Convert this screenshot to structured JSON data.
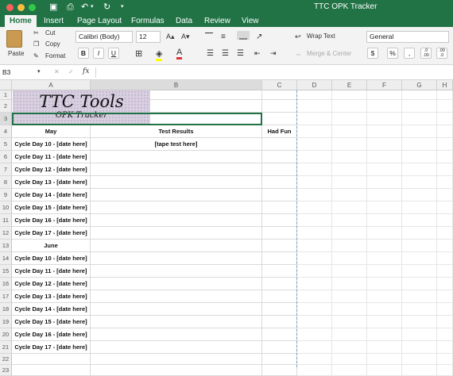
{
  "window": {
    "title": "TTC OPK Tracker"
  },
  "tabs": [
    "Home",
    "Insert",
    "Page Layout",
    "Formulas",
    "Data",
    "Review",
    "View"
  ],
  "ribbon": {
    "paste": "Paste",
    "cut": "Cut",
    "copy": "Copy",
    "format": "Format",
    "font_name": "Calibri (Body)",
    "font_size": "12",
    "bold": "B",
    "italic": "I",
    "underline": "U",
    "wrap_text": "Wrap Text",
    "merge_center": "Merge & Center",
    "number_format": "General",
    "currency": "$",
    "percent": "%",
    "comma": ",",
    "inc_decimal": ".0 .00",
    "dec_decimal": ".00 .0"
  },
  "formula_bar": {
    "name_box": "B3",
    "fx": "fx",
    "content": ""
  },
  "columns": [
    "A",
    "B",
    "C",
    "D",
    "E",
    "F",
    "G",
    "H"
  ],
  "rows": [
    "1",
    "2",
    "3",
    "4",
    "5",
    "6",
    "7",
    "8",
    "9",
    "10",
    "11",
    "12",
    "13",
    "14",
    "15",
    "16",
    "17",
    "18",
    "19",
    "20",
    "21",
    "22",
    "23"
  ],
  "logo": {
    "title": "TTC Tools",
    "subtitle": "OPK Tracker"
  },
  "sheet": {
    "headers": {
      "a": "May",
      "b": "Test Results",
      "c": "Had Fun"
    },
    "rows": [
      {
        "row": "5",
        "a": "Cycle Day 10 - [date here]",
        "b": "[tape test here]"
      },
      {
        "row": "6",
        "a": "Cycle Day 11 - [date here]",
        "b": ""
      },
      {
        "row": "7",
        "a": "Cycle Day 12 - [date here]",
        "b": ""
      },
      {
        "row": "8",
        "a": "Cycle Day 13 - [date here]",
        "b": ""
      },
      {
        "row": "9",
        "a": "Cycle Day 14 - [date here]",
        "b": ""
      },
      {
        "row": "10",
        "a": "Cycle Day 15 - [date here]",
        "b": ""
      },
      {
        "row": "11",
        "a": "Cycle Day 16 - [date here]",
        "b": ""
      },
      {
        "row": "12",
        "a": "Cycle Day 17 - [date here]",
        "b": ""
      },
      {
        "row": "13",
        "a": "June",
        "b": ""
      },
      {
        "row": "14",
        "a": "Cycle Day 10 - [date here]",
        "b": ""
      },
      {
        "row": "15",
        "a": "Cycle Day 11 - [date here]",
        "b": ""
      },
      {
        "row": "16",
        "a": "Cycle Day 12 - [date here]",
        "b": ""
      },
      {
        "row": "17",
        "a": "Cycle Day 13 - [date here]",
        "b": ""
      },
      {
        "row": "18",
        "a": "Cycle Day 14 - [date here]",
        "b": ""
      },
      {
        "row": "19",
        "a": "Cycle Day 15 - [date here]",
        "b": ""
      },
      {
        "row": "20",
        "a": "Cycle Day 16 - [date here]",
        "b": ""
      },
      {
        "row": "21",
        "a": "Cycle Day 17 - [date here]",
        "b": ""
      }
    ]
  },
  "colors": {
    "accent": "#217346",
    "logo_bg": "#d8cfe0"
  }
}
